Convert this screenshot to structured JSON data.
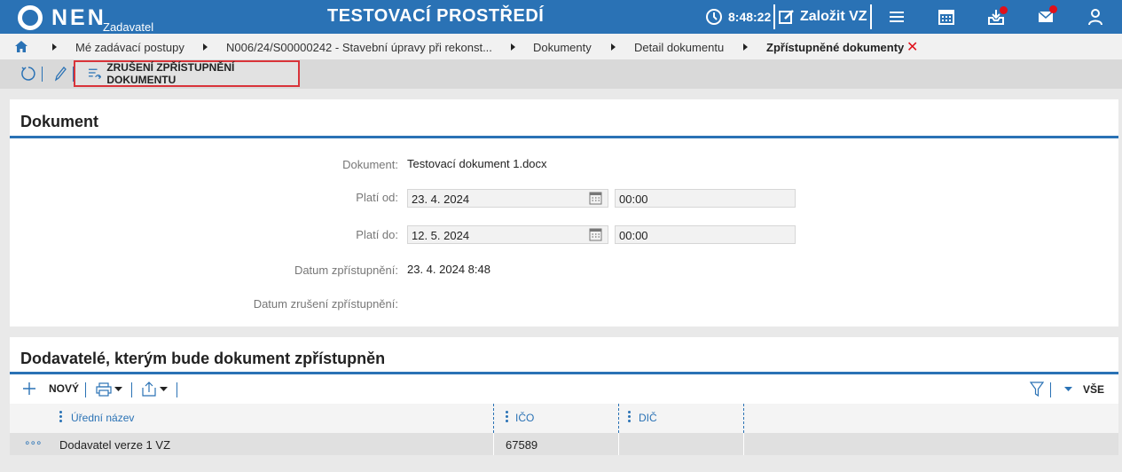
{
  "header": {
    "logo_text": "NEN",
    "logo_sub": "Zadavatel",
    "env_title": "TESTOVACÍ PROSTŘEDÍ",
    "time": "8:48:22",
    "create_label": "Založit VZ"
  },
  "breadcrumb": {
    "items": [
      "Mé zadávací postupy",
      "N006/24/S00000242 - Stavební úpravy při rekonst...",
      "Dokumenty",
      "Detail dokumentu",
      "Zpřístupněné dokumenty"
    ],
    "close": "✕"
  },
  "toolbar": {
    "cancel_label": "ZRUŠENÍ ZPŘÍSTUPNĚNÍ DOKUMENTU"
  },
  "document": {
    "title": "Dokument",
    "fields": {
      "document_label": "Dokument:",
      "document_value": "Testovací dokument 1.docx",
      "valid_from_label": "Platí od:",
      "valid_from_date": "23. 4. 2024",
      "valid_from_time": "00:00",
      "valid_to_label": "Platí do:",
      "valid_to_date": "12. 5. 2024",
      "valid_to_time": "00:00",
      "access_date_label": "Datum zpřístupnění:",
      "access_date_value": "23. 4. 2024 8:48",
      "cancel_date_label": "Datum zrušení zpřístupnění:",
      "cancel_date_value": ""
    }
  },
  "suppliers": {
    "title": "Dodavatelé, kterým bude dokument zpřístupněn",
    "new_label": "NOVÝ",
    "filter_label": "VŠE",
    "columns": [
      "Úřední název",
      "IČO",
      "DIČ"
    ],
    "rows": [
      {
        "menu": "∘∘∘",
        "name": "Dodavatel verze 1 VZ",
        "ico": "67589",
        "dic": ""
      }
    ]
  },
  "colors": {
    "brand": "#2a72b5",
    "alert": "#e0101a",
    "highlight_border": "#d9343a"
  }
}
